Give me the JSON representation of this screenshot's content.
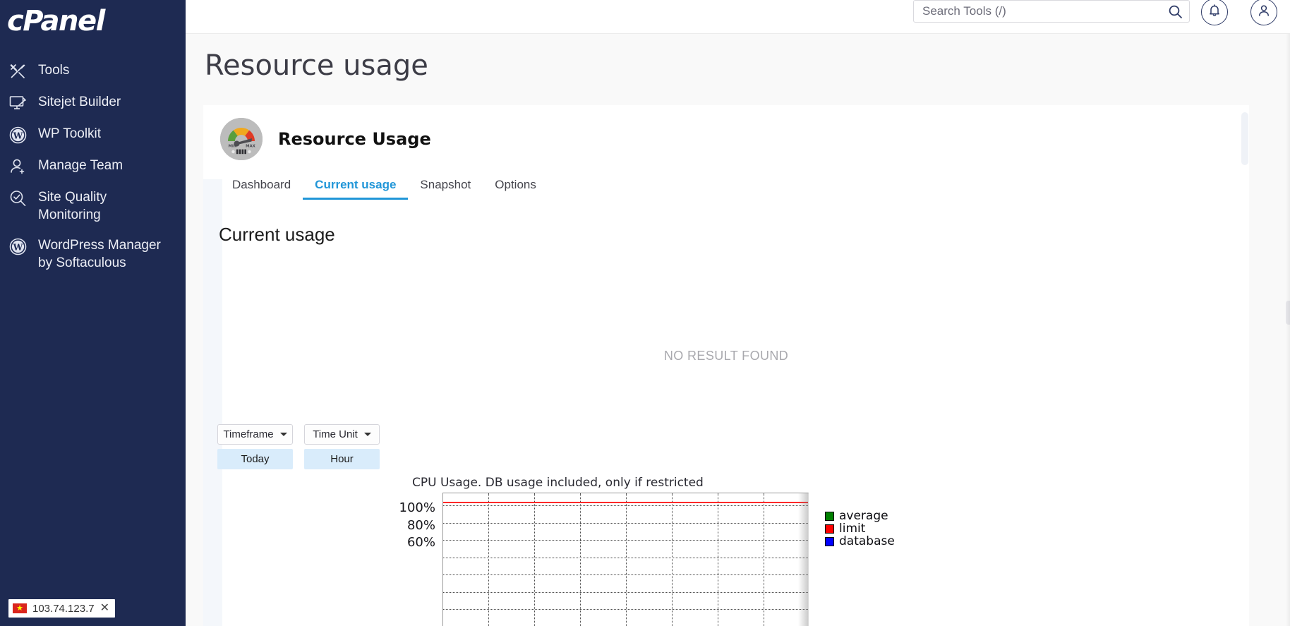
{
  "sidebar": {
    "brand": "cPanel",
    "items": [
      {
        "label": "Tools",
        "icon": "tools-icon"
      },
      {
        "label": "Sitejet Builder",
        "icon": "monitor-pencil-icon"
      },
      {
        "label": "WP Toolkit",
        "icon": "wordpress-icon"
      },
      {
        "label": "Manage Team",
        "icon": "user-plus-icon"
      },
      {
        "label": "Site Quality Monitoring",
        "icon": "magnifier-check-icon"
      },
      {
        "label": "WordPress Manager by Softaculous",
        "icon": "wordpress-icon"
      }
    ],
    "ip_badge": {
      "flag": "vietnam-flag-icon",
      "ip": "103.74.123.7",
      "close": "✕"
    }
  },
  "topbar": {
    "search_placeholder": "Search Tools (/)",
    "search_value": "",
    "search_icon": "search-icon",
    "notifications_icon": "bell-icon",
    "account_icon": "user-icon"
  },
  "page": {
    "title": "Resource usage"
  },
  "app": {
    "icon": "resource-usage-gauge-icon",
    "title": "Resource Usage",
    "tabs": [
      {
        "label": "Dashboard",
        "active": false
      },
      {
        "label": "Current usage",
        "active": true
      },
      {
        "label": "Snapshot",
        "active": false
      },
      {
        "label": "Options",
        "active": false
      }
    ],
    "section_title": "Current usage",
    "empty_state": "NO RESULT FOUND"
  },
  "controls": {
    "timeframe": {
      "label": "Timeframe",
      "value": "Today"
    },
    "time_unit": {
      "label": "Time Unit",
      "value": "Hour"
    }
  },
  "colors": {
    "sidebar_bg": "#1e2a52",
    "accent_blue": "#2196d8",
    "selected_blue": "#d9ecfb",
    "limit_red": "#fd2a2a",
    "average_green": "#008000",
    "database_blue": "#0000ff",
    "page_bg": "#f9f9f9"
  },
  "chart_data": {
    "type": "line",
    "title": "CPU Usage. DB usage included, only if restricted",
    "xlabel": "",
    "ylabel": "",
    "ylim": [
      0,
      105
    ],
    "ytick_labels": [
      "100%",
      "80%",
      "60%"
    ],
    "ytick_values": [
      100,
      80,
      60
    ],
    "grid": true,
    "legend_position": "right",
    "x": [],
    "series": [
      {
        "name": "average",
        "color": "#008000",
        "values": []
      },
      {
        "name": "limit",
        "color": "#ff0000",
        "values": [
          100
        ]
      },
      {
        "name": "database",
        "color": "#0000ff",
        "values": []
      }
    ],
    "annotations": [
      "limit line drawn at 100%"
    ],
    "vertical_gridline_count": 7
  }
}
